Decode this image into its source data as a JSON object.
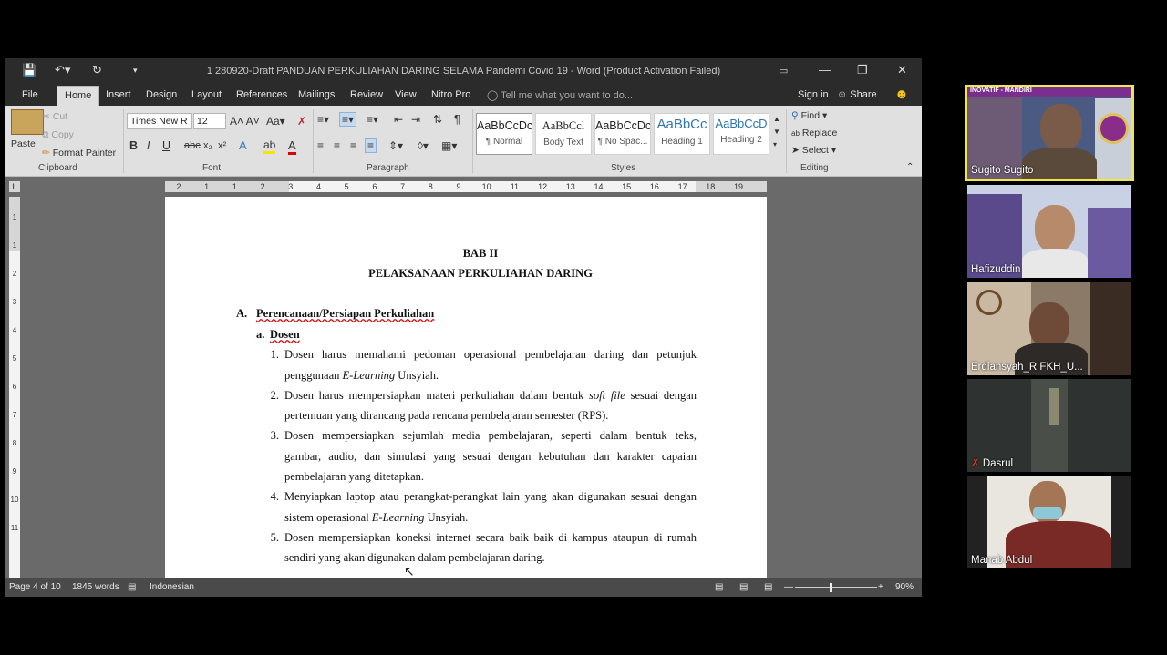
{
  "window": {
    "title": "1 280920-Draft PANDUAN PERKULIAHAN DARING SELAMA Pandemi Covid 19 - Word (Product Activation Failed)"
  },
  "menu": {
    "tabs": [
      "File",
      "Home",
      "Insert",
      "Design",
      "Layout",
      "References",
      "Mailings",
      "Review",
      "View",
      "Nitro Pro"
    ],
    "tell_me": "Tell me what you want to do...",
    "sign_in": "Sign in",
    "share": "Share"
  },
  "ribbon": {
    "clipboard": {
      "paste": "Paste",
      "cut": "Cut",
      "copy": "Copy",
      "format_painter": "Format Painter",
      "label": "Clipboard"
    },
    "font": {
      "name": "Times New R",
      "size": "12",
      "label": "Font"
    },
    "paragraph": {
      "label": "Paragraph"
    },
    "styles": {
      "label": "Styles",
      "items": [
        {
          "preview": "AaBbCcDc",
          "name": "¶ Normal"
        },
        {
          "preview": "AaBbCcl",
          "name": "Body Text"
        },
        {
          "preview": "AaBbCcDc",
          "name": "¶ No Spac..."
        },
        {
          "preview": "AaBbCc",
          "name": "Heading 1"
        },
        {
          "preview": "AaBbCcD",
          "name": "Heading 2"
        }
      ]
    },
    "editing": {
      "find": "Find",
      "replace": "Replace",
      "select": "Select",
      "label": "Editing"
    }
  },
  "ruler": {
    "h_ticks": [
      "2",
      "1",
      "1",
      "2",
      "3",
      "4",
      "5",
      "6",
      "7",
      "8",
      "9",
      "10",
      "11",
      "12",
      "13",
      "14",
      "15",
      "16",
      "17",
      "18",
      "19"
    ],
    "v_ticks": [
      "1",
      "1",
      "2",
      "3",
      "4",
      "5",
      "6",
      "7",
      "8",
      "9",
      "10",
      "11"
    ]
  },
  "document": {
    "chapter": "BAB II",
    "chapter_title": "PELAKSANAAN PERKULIAHAN DARING",
    "section_letter": "A.",
    "section_title": "Perencanaan/Persiapan Perkuliahan",
    "sub_letter": "a.",
    "sub_title": "Dosen",
    "items": [
      {
        "num": "1.",
        "lines": [
          "Dosen harus memahami pedoman operasional pembelajaran daring dan petunjuk",
          "penggunaan E-Learning Unsyiah."
        ]
      },
      {
        "num": "2.",
        "lines": [
          "Dosen harus mempersiapkan materi perkuliahan dalam bentuk soft file sesuai dengan",
          "pertemuan yang dirancang pada rencana pembelajaran semester (RPS)."
        ]
      },
      {
        "num": "3.",
        "lines": [
          "Dosen mempersiapkan sejumlah media pembelajaran, seperti dalam bentuk teks,",
          "gambar, audio, dan simulasi yang sesuai dengan kebutuhan dan karakter capaian",
          "pembelajaran yang ditetapkan."
        ]
      },
      {
        "num": "4.",
        "lines": [
          "Menyiapkan laptop atau perangkat-perangkat lain yang akan digunakan sesuai dengan",
          "sistem operasional E-Learning Unsyiah."
        ]
      },
      {
        "num": "5.",
        "lines": [
          "Dosen mempersiapkan koneksi internet secara baik baik di kampus ataupun di rumah",
          "sendiri yang akan digunakan dalam pembelajaran daring."
        ]
      }
    ]
  },
  "status": {
    "page": "Page 4 of 10",
    "words": "1845 words",
    "language": "Indonesian",
    "zoom": "90%"
  },
  "participants": [
    {
      "name": "Sugito Sugito",
      "banner": "INOVATIF - MANDIRI",
      "active": true,
      "muted": false
    },
    {
      "name": "Hafizuddin",
      "active": false,
      "muted": false
    },
    {
      "name": "Erdiansyah_R FKH_U...",
      "active": false,
      "muted": false
    },
    {
      "name": "Dasrul",
      "active": false,
      "muted": true
    },
    {
      "name": "Manab Abdul",
      "active": false,
      "muted": false
    }
  ]
}
